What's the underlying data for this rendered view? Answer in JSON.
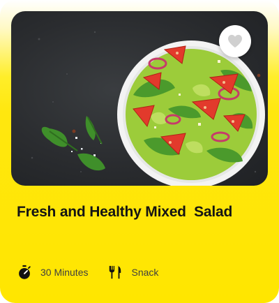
{
  "card": {
    "title": "Fresh and Healthy Mixed  Salad",
    "image_alt": "Bowl of fresh mixed salad with tomatoes, lettuce and red onion on a dark stone surface",
    "favorite_icon": "heart-icon",
    "meta": [
      {
        "icon": "timer-icon",
        "label": "30 Minutes"
      },
      {
        "icon": "fork-knife-icon",
        "label": "Snack"
      }
    ]
  },
  "colors": {
    "card_yellow": "#ffe600",
    "title_text": "#141414",
    "meta_text": "#3f3f3f",
    "heart_gray": "#d0d0d0"
  }
}
